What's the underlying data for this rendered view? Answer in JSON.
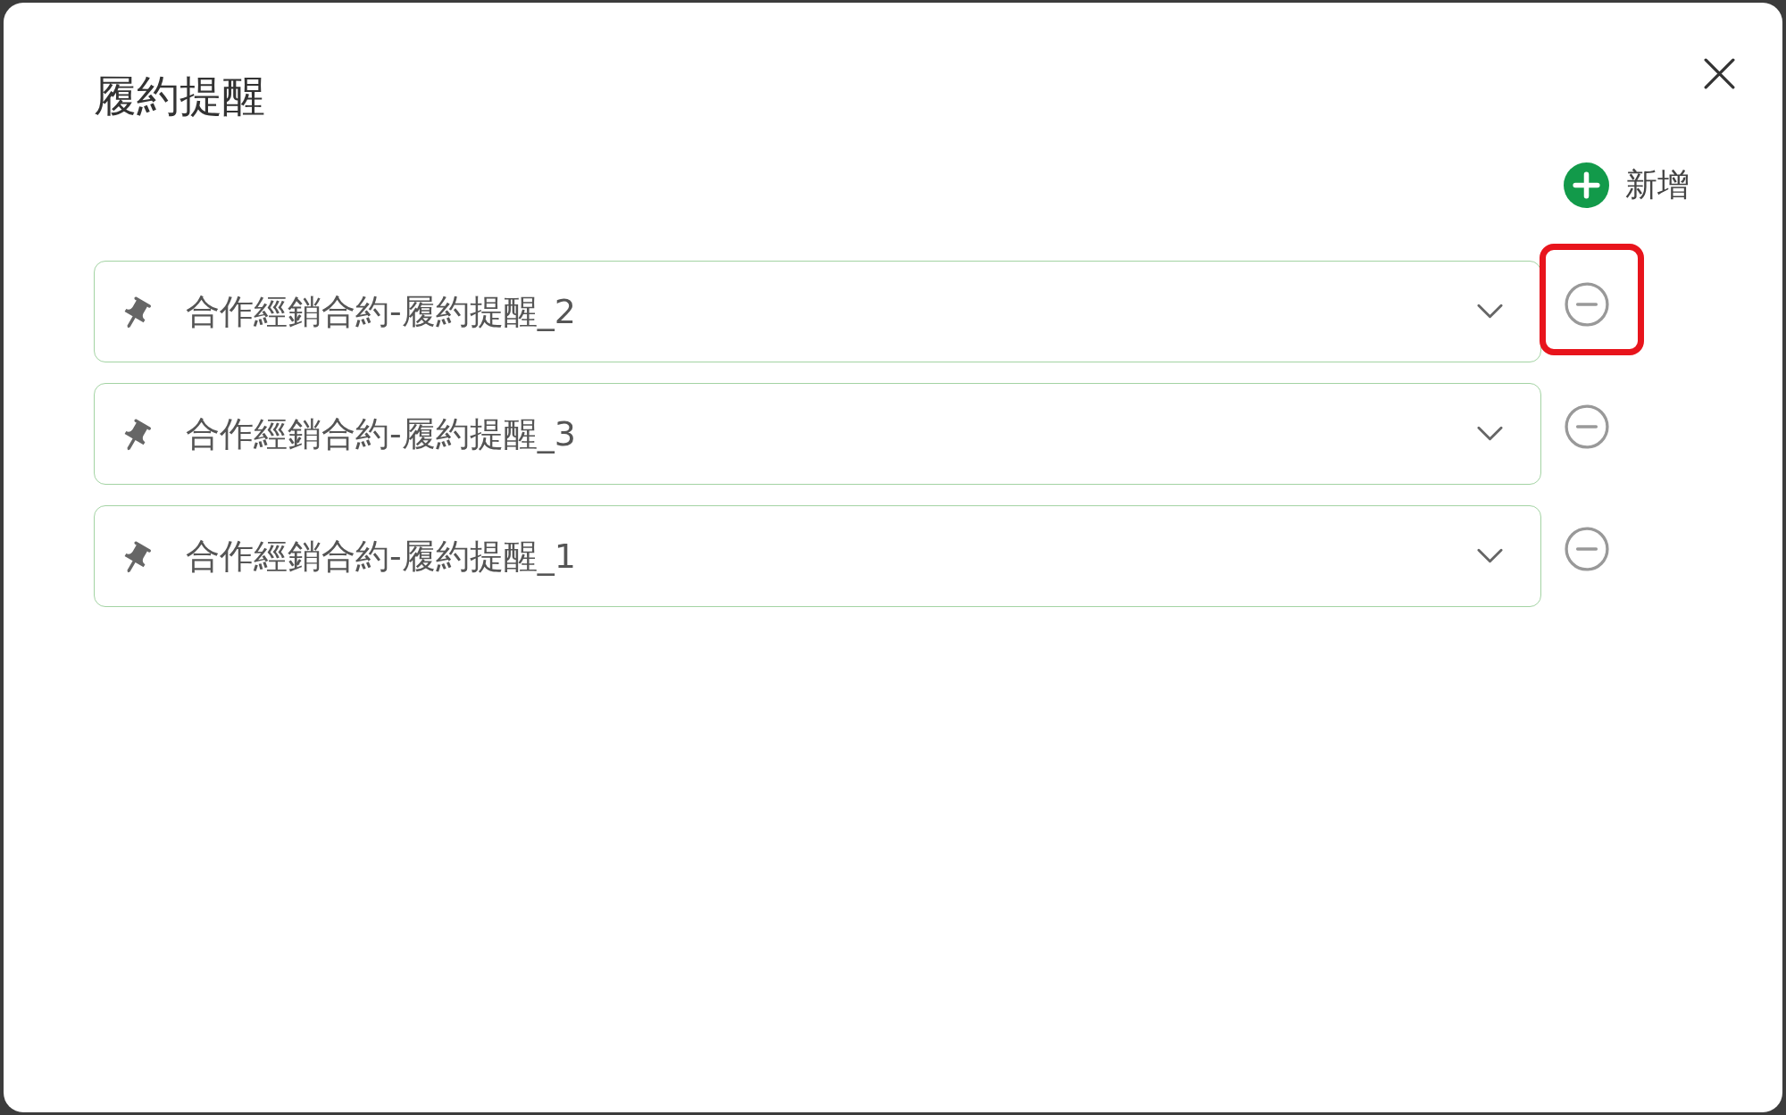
{
  "dialog": {
    "title": "履約提醒"
  },
  "add_button": {
    "label": "新增"
  },
  "reminders": [
    {
      "name": "合作經銷合約-履約提醒_2",
      "highlighted": true
    },
    {
      "name": "合作經銷合約-履約提醒_3",
      "highlighted": false
    },
    {
      "name": "合作經銷合約-履約提醒_1",
      "highlighted": false
    }
  ]
}
